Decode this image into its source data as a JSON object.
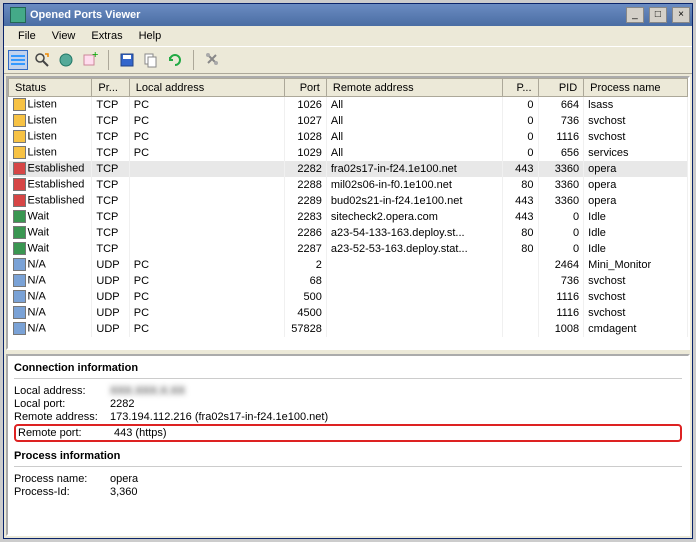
{
  "window": {
    "title": "Opened Ports Viewer"
  },
  "menu": {
    "file": "File",
    "view": "View",
    "extras": "Extras",
    "help": "Help"
  },
  "columns": {
    "status": "Status",
    "proto": "Pr...",
    "local": "Local address",
    "port": "Port",
    "remote": "Remote address",
    "rport": "P...",
    "pid": "PID",
    "pname": "Process name"
  },
  "rows": [
    {
      "ic": "y",
      "status": "Listen",
      "proto": "TCP",
      "local": "PC",
      "port": "1026",
      "remote": "All",
      "rport": "0",
      "pid": "664",
      "pname": "lsass"
    },
    {
      "ic": "y",
      "status": "Listen",
      "proto": "TCP",
      "local": "PC",
      "port": "1027",
      "remote": "All",
      "rport": "0",
      "pid": "736",
      "pname": "svchost"
    },
    {
      "ic": "y",
      "status": "Listen",
      "proto": "TCP",
      "local": "PC",
      "port": "1028",
      "remote": "All",
      "rport": "0",
      "pid": "1116",
      "pname": "svchost"
    },
    {
      "ic": "y",
      "status": "Listen",
      "proto": "TCP",
      "local": "PC",
      "port": "1029",
      "remote": "All",
      "rport": "0",
      "pid": "656",
      "pname": "services"
    },
    {
      "ic": "r",
      "status": "Established",
      "proto": "TCP",
      "local": "",
      "port": "2282",
      "remote": "fra02s17-in-f24.1e100.net",
      "rport": "443",
      "pid": "3360",
      "pname": "opera",
      "sel": true
    },
    {
      "ic": "r",
      "status": "Established",
      "proto": "TCP",
      "local": "",
      "port": "2288",
      "remote": "mil02s06-in-f0.1e100.net",
      "rport": "80",
      "pid": "3360",
      "pname": "opera"
    },
    {
      "ic": "r",
      "status": "Established",
      "proto": "TCP",
      "local": "",
      "port": "2289",
      "remote": "bud02s21-in-f24.1e100.net",
      "rport": "443",
      "pid": "3360",
      "pname": "opera"
    },
    {
      "ic": "g",
      "status": "Wait",
      "proto": "TCP",
      "local": "",
      "port": "2283",
      "remote": "sitecheck2.opera.com",
      "rport": "443",
      "pid": "0",
      "pname": "Idle"
    },
    {
      "ic": "g",
      "status": "Wait",
      "proto": "TCP",
      "local": "",
      "port": "2286",
      "remote": "a23-54-133-163.deploy.st...",
      "rport": "80",
      "pid": "0",
      "pname": "Idle"
    },
    {
      "ic": "g",
      "status": "Wait",
      "proto": "TCP",
      "local": "",
      "port": "2287",
      "remote": "a23-52-53-163.deploy.stat...",
      "rport": "80",
      "pid": "0",
      "pname": "Idle"
    },
    {
      "ic": "b",
      "status": "N/A",
      "proto": "UDP",
      "local": "PC",
      "port": "2",
      "remote": "",
      "rport": "",
      "pid": "2464",
      "pname": "Mini_Monitor"
    },
    {
      "ic": "b",
      "status": "N/A",
      "proto": "UDP",
      "local": "PC",
      "port": "68",
      "remote": "",
      "rport": "",
      "pid": "736",
      "pname": "svchost"
    },
    {
      "ic": "b",
      "status": "N/A",
      "proto": "UDP",
      "local": "PC",
      "port": "500",
      "remote": "",
      "rport": "",
      "pid": "1116",
      "pname": "svchost"
    },
    {
      "ic": "b",
      "status": "N/A",
      "proto": "UDP",
      "local": "PC",
      "port": "4500",
      "remote": "",
      "rport": "",
      "pid": "1116",
      "pname": "svchost"
    },
    {
      "ic": "b",
      "status": "N/A",
      "proto": "UDP",
      "local": "PC",
      "port": "57828",
      "remote": "",
      "rport": "",
      "pid": "1008",
      "pname": "cmdagent"
    }
  ],
  "details": {
    "conn_info_title": "Connection information",
    "proc_info_title": "Process information",
    "local_addr_k": "Local address:",
    "local_addr_v": "XXX.XXX.X.XX",
    "local_port_k": "Local port:",
    "local_port_v": "2282",
    "remote_addr_k": "Remote address:",
    "remote_addr_v": "173.194.112.216 (fra02s17-in-f24.1e100.net)",
    "remote_port_k": "Remote port:",
    "remote_port_v": "443 (https)",
    "pname_k": "Process name:",
    "pname_v": "opera",
    "pid_k": "Process-Id:",
    "pid_v": "3,360"
  }
}
